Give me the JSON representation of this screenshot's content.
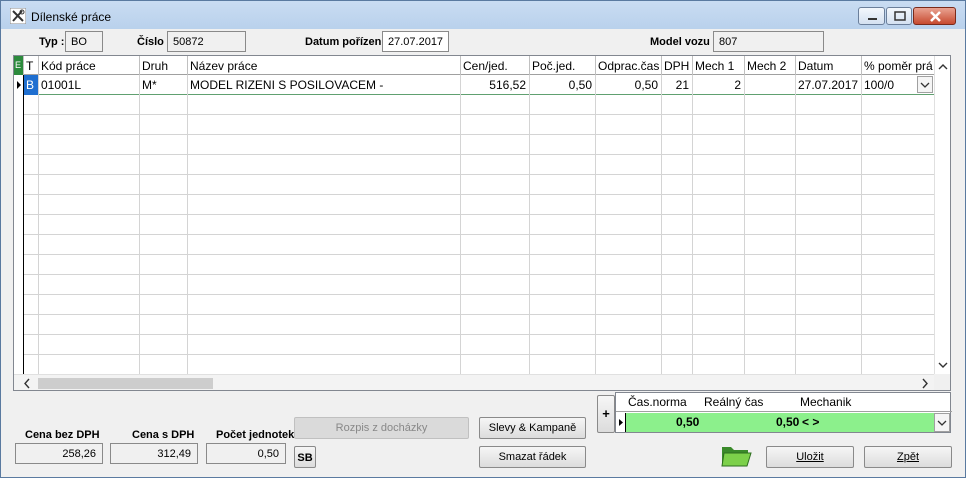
{
  "window": {
    "title": "Dílenské práce",
    "icon": "tools-icon"
  },
  "header": {
    "typ_label": "Typ :",
    "typ_value": "BO",
    "cislo_label": "Číslo :",
    "cislo_value": "50872",
    "datum_label": "Datum pořízení :",
    "datum_value": "27.07.2017",
    "model_label": "Model vozu :",
    "model_value": "807"
  },
  "grid": {
    "columns": [
      "E",
      "T",
      "Kód práce",
      "Druh",
      "Název práce",
      "Cen/jed.",
      "Poč.jed.",
      "Odprac.čas",
      "DPH",
      "Mech 1",
      "Mech 2",
      "Datum",
      "% poměr prá"
    ],
    "rows": [
      {
        "t": "B",
        "kod": "01001L",
        "druh": "M*",
        "nazev": "MODEL RIZENI S POSILOVACEM -",
        "cena": "516,52",
        "poc": "0,50",
        "odprac": "0,50",
        "dph": "21",
        "mech1": "2",
        "mech2": "",
        "datum": "27.07.2017",
        "pomer": "100/0"
      }
    ]
  },
  "totals": {
    "cena_bez_label": "Cena bez DPH",
    "cena_bez_value": "258,26",
    "cena_s_label": "Cena s DPH",
    "cena_s_value": "312,49",
    "pocet_label": "Počet jednotek",
    "pocet_value": "0,50"
  },
  "buttons": {
    "rozpis": "Rozpis z docházky",
    "slevy": "Slevy & Kampaně",
    "smazat": "Smazat řádek",
    "sb": "SB",
    "ulozit": "Uložit",
    "zpet": "Zpět",
    "plus": "+"
  },
  "summary": {
    "columns": [
      "Čas.norma",
      "Reálný čas",
      "Mechanik"
    ],
    "values": [
      "0,50",
      "0,50",
      "< >"
    ]
  },
  "colors": {
    "accent_green": "#8cf08c",
    "type_blue": "#1f6fd0",
    "e_green": "#2c8a3c"
  }
}
